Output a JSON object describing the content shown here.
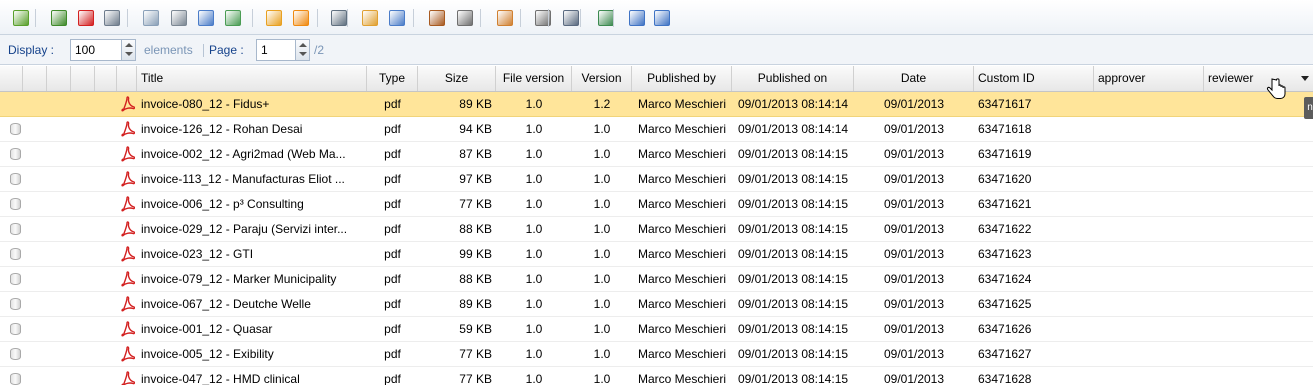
{
  "toolbar": {
    "icons": [
      "refresh-icon",
      "download-icon",
      "pdf-convert-icon",
      "copy-icon",
      "new-document-icon",
      "scan-icon",
      "save-icon",
      "export-icon",
      "rss-feed-icon",
      "rss-icon",
      "secure-icon",
      "bulk-edit-icon",
      "edit-icon",
      "stamp-icon",
      "settings-icon",
      "report-icon",
      "filter-icon",
      "print-icon",
      "import-icon",
      "list-view-icon",
      "grid-view-icon"
    ]
  },
  "paging": {
    "display_label": "Display :",
    "display_value": "100",
    "elements_label": "elements",
    "page_label": "Page :",
    "page_value": "1",
    "total_pages": "/2"
  },
  "columns": [
    "Title",
    "Type",
    "Size",
    "File version",
    "Version",
    "Published by",
    "Published on",
    "Date",
    "Custom ID",
    "approver",
    "reviewer"
  ],
  "rows": [
    {
      "title": "invoice-080_12 - Fidus+",
      "type": "pdf",
      "size": "89 KB",
      "file_version": "1.0",
      "version": "1.2",
      "published_by": "Marco Meschieri",
      "published_on": "09/01/2013 08:14:14",
      "date": "09/01/2013",
      "custom_id": "63471617"
    },
    {
      "title": "invoice-126_12 - Rohan Desai",
      "type": "pdf",
      "size": "94 KB",
      "file_version": "1.0",
      "version": "1.0",
      "published_by": "Marco Meschieri",
      "published_on": "09/01/2013 08:14:14",
      "date": "09/01/2013",
      "custom_id": "63471618"
    },
    {
      "title": "invoice-002_12 - Agri2mad (Web Ma...",
      "type": "pdf",
      "size": "87 KB",
      "file_version": "1.0",
      "version": "1.0",
      "published_by": "Marco Meschieri",
      "published_on": "09/01/2013 08:14:15",
      "date": "09/01/2013",
      "custom_id": "63471619"
    },
    {
      "title": "invoice-113_12 - Manufacturas Eliot ...",
      "type": "pdf",
      "size": "97 KB",
      "file_version": "1.0",
      "version": "1.0",
      "published_by": "Marco Meschieri",
      "published_on": "09/01/2013 08:14:15",
      "date": "09/01/2013",
      "custom_id": "63471620"
    },
    {
      "title": "invoice-006_12 - p³ Consulting",
      "type": "pdf",
      "size": "77 KB",
      "file_version": "1.0",
      "version": "1.0",
      "published_by": "Marco Meschieri",
      "published_on": "09/01/2013 08:14:15",
      "date": "09/01/2013",
      "custom_id": "63471621"
    },
    {
      "title": "invoice-029_12 - Paraju (Servizi inter...",
      "type": "pdf",
      "size": "88 KB",
      "file_version": "1.0",
      "version": "1.0",
      "published_by": "Marco Meschieri",
      "published_on": "09/01/2013 08:14:15",
      "date": "09/01/2013",
      "custom_id": "63471622"
    },
    {
      "title": "invoice-023_12 - GTI",
      "type": "pdf",
      "size": "99 KB",
      "file_version": "1.0",
      "version": "1.0",
      "published_by": "Marco Meschieri",
      "published_on": "09/01/2013 08:14:15",
      "date": "09/01/2013",
      "custom_id": "63471623"
    },
    {
      "title": "invoice-079_12 - Marker Municipality",
      "type": "pdf",
      "size": "88 KB",
      "file_version": "1.0",
      "version": "1.0",
      "published_by": "Marco Meschieri",
      "published_on": "09/01/2013 08:14:15",
      "date": "09/01/2013",
      "custom_id": "63471624"
    },
    {
      "title": "invoice-067_12 - Deutche Welle",
      "type": "pdf",
      "size": "89 KB",
      "file_version": "1.0",
      "version": "1.0",
      "published_by": "Marco Meschieri",
      "published_on": "09/01/2013 08:14:15",
      "date": "09/01/2013",
      "custom_id": "63471625"
    },
    {
      "title": "invoice-001_12 - Quasar",
      "type": "pdf",
      "size": "59 KB",
      "file_version": "1.0",
      "version": "1.0",
      "published_by": "Marco Meschieri",
      "published_on": "09/01/2013 08:14:15",
      "date": "09/01/2013",
      "custom_id": "63471626"
    },
    {
      "title": "invoice-005_12 - Exibility",
      "type": "pdf",
      "size": "77 KB",
      "file_version": "1.0",
      "version": "1.0",
      "published_by": "Marco Meschieri",
      "published_on": "09/01/2013 08:14:15",
      "date": "09/01/2013",
      "custom_id": "63471627"
    },
    {
      "title": "invoice-047_12 - HMD clinical",
      "type": "pdf",
      "size": "77 KB",
      "file_version": "1.0",
      "version": "1.0",
      "published_by": "Marco Meschieri",
      "published_on": "09/01/2013 08:14:15",
      "date": "09/01/2013",
      "custom_id": "63471628"
    }
  ],
  "selected_row": 0,
  "colors": {
    "selected_row": "#ffe59a",
    "link_blue": "#15428b",
    "pdf_red": "#d32020"
  }
}
